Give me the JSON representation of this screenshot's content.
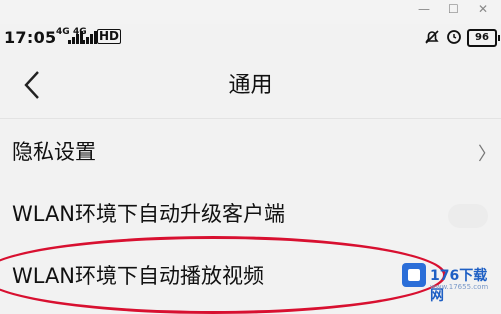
{
  "status_bar": {
    "time": "17:05",
    "net1": "4G",
    "net2": "4G",
    "hd": "HD",
    "battery": "96"
  },
  "nav": {
    "title": "通用"
  },
  "rows": [
    {
      "label": "隐私设置"
    },
    {
      "label": "WLAN环境下自动升级客户端"
    },
    {
      "label": "WLAN环境下自动播放视频"
    }
  ],
  "watermark": {
    "brand": "176下载网",
    "site": "www.17655.com"
  }
}
